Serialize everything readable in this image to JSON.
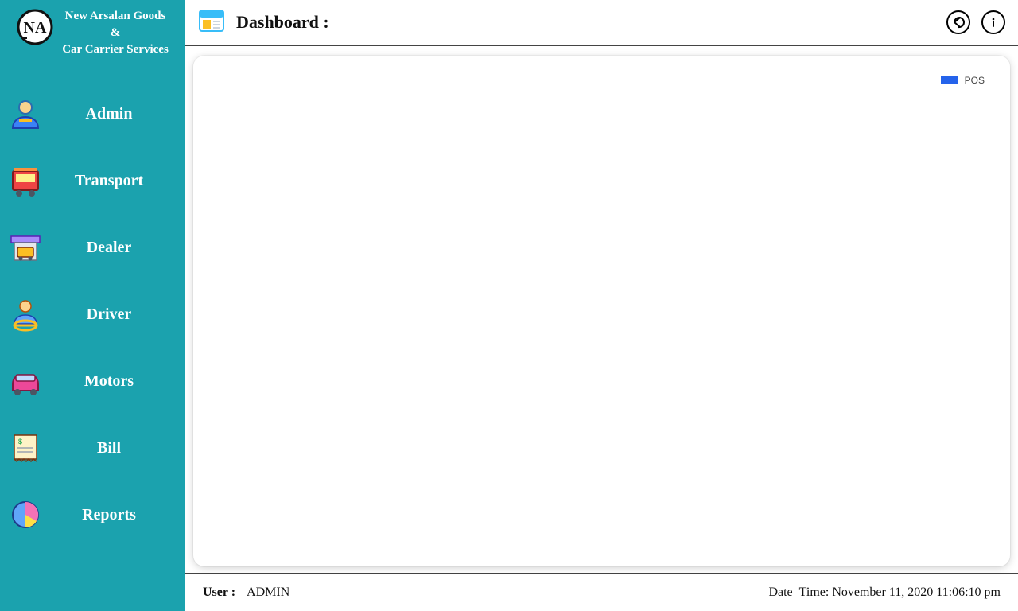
{
  "brand": {
    "line1": "New Arsalan Goods",
    "line2": "&",
    "line3": "Car Carrier Services"
  },
  "sidebar": {
    "items": [
      {
        "label": "Admin"
      },
      {
        "label": "Transport"
      },
      {
        "label": "Dealer"
      },
      {
        "label": "Driver"
      },
      {
        "label": "Motors"
      },
      {
        "label": "Bill"
      },
      {
        "label": "Reports"
      }
    ]
  },
  "header": {
    "title": "Dashboard :"
  },
  "legend": {
    "label": "POS",
    "color": "#2563eb"
  },
  "statusbar": {
    "user_label": "User :",
    "user_value": "ADMIN",
    "datetime_label": "Date_Time:",
    "datetime_value": "November 11, 2020 11:06:10 pm"
  }
}
